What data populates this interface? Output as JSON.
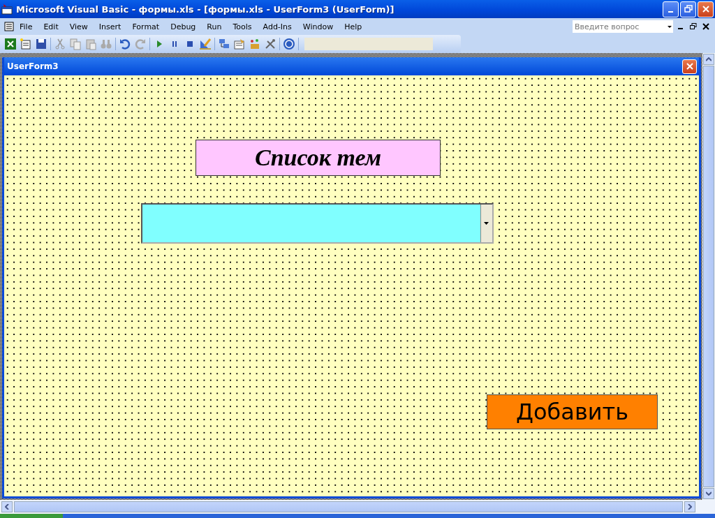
{
  "window": {
    "title": "Microsoft Visual Basic - формы.xls - [формы.xls - UserForm3 (UserForm)]"
  },
  "menu": [
    {
      "label": "File"
    },
    {
      "label": "Edit"
    },
    {
      "label": "View"
    },
    {
      "label": "Insert"
    },
    {
      "label": "Format"
    },
    {
      "label": "Debug"
    },
    {
      "label": "Run"
    },
    {
      "label": "Tools"
    },
    {
      "label": "Add-Ins"
    },
    {
      "label": "Window"
    },
    {
      "label": "Help"
    }
  ],
  "help_search": {
    "placeholder": "Введите вопрос"
  },
  "form": {
    "title": "UserForm3",
    "label": "Список тем",
    "button": "Добавить"
  }
}
